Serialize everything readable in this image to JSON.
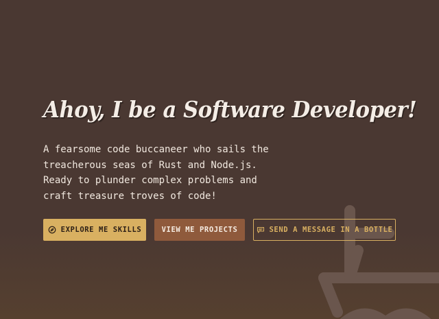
{
  "hero": {
    "title": "Ahoy, I be a Software Developer!",
    "description_lines": [
      "A fearsome code buccaneer who sails the",
      "treacherous seas of Rust and Node.js.",
      "Ready to plunder complex problems and",
      "craft treasure troves of code!"
    ]
  },
  "buttons": {
    "skills": {
      "label": "EXPLORE ME SKILLS",
      "icon": "compass-icon"
    },
    "projects": {
      "label": "VIEW ME PROJECTS"
    },
    "message": {
      "label": "SEND A MESSAGE IN A BOTTLE",
      "icon": "message-icon"
    }
  },
  "colors": {
    "background": "#4a3832",
    "gold": "#d9b061",
    "rust": "#8f5a3c",
    "text": "#f4ede6"
  },
  "decoration": {
    "icon": "ship-icon"
  }
}
